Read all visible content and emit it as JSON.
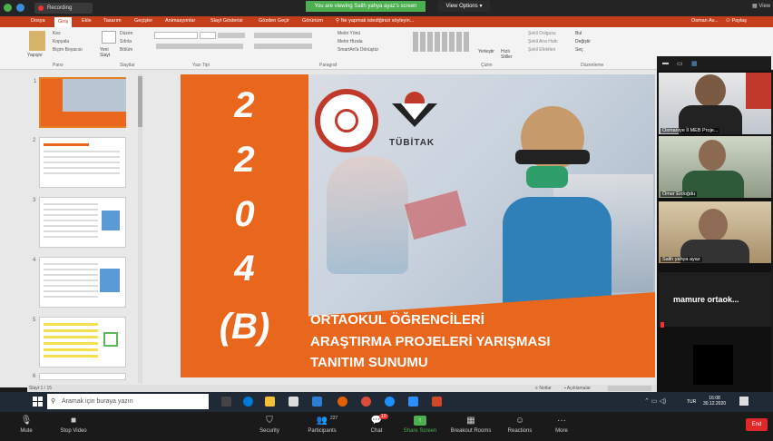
{
  "zoom_top": {
    "recording_label": "Recording",
    "share_banner": "You are viewing Salih yahya ayaz's screen",
    "view_options": "View Options",
    "view_label": "View"
  },
  "ppt": {
    "tabs": [
      "Dosya",
      "Giriş",
      "Ekle",
      "Tasarım",
      "Geçişler",
      "Animasyonlar",
      "Slayt Gösterisi",
      "Gözden Geçir",
      "Görünüm",
      "Ne yapmak istediğinizi söyleyin..."
    ],
    "user": "Osman Av...",
    "share_label": "Paylaş",
    "ribbon_groups": [
      "Pano",
      "Slaytlar",
      "Yazı Tipi",
      "Paragraf",
      "Çizim",
      "Düzenleme"
    ],
    "ribbon_buttons": {
      "paste": "Yapıştır",
      "cut": "Kes",
      "copy": "Kopyala",
      "format_painter": "Biçim Boyacısı",
      "new_slide": "Yeni Slayt",
      "layout": "Düzen",
      "reset": "Sıfırla",
      "section": "Bölüm",
      "text_direction": "Metin Yönü",
      "align_text": "Metni Hizala",
      "smartart": "SmartArt'a Dönüştür",
      "arrange": "Yerleştir",
      "quick_styles": "Hızlı Stiller",
      "shape_fill": "Şekil Dolgusu",
      "shape_outline": "Şekil Ana Hattı",
      "shape_effects": "Şekil Efektleri",
      "find": "Bul",
      "replace": "Değiştir",
      "select": "Seç"
    },
    "thumbnail_numbers": [
      "1",
      "2",
      "3",
      "4",
      "5",
      "6"
    ],
    "slide": {
      "year_digits": [
        "2",
        "2",
        "0",
        "4"
      ],
      "code": "(B)",
      "tubitak_label": "TÜBİTAK",
      "line1": "ORTAOKUL ÖĞRENCİLERİ",
      "line2": "ARAŞTIRMA PROJELERİ YARIŞMASI",
      "line3": "TANITIM SUNUMU"
    },
    "status": {
      "slide_count": "Slayt 1 / 15",
      "notes": "Notlar",
      "comments": "Açıklamalar"
    }
  },
  "gallery": {
    "participants": [
      {
        "name": "Osmaniye İl MEB Proje..."
      },
      {
        "name": "Ömer Erdoğdu"
      },
      {
        "name": "Salih yahya ayaz"
      }
    ],
    "active_speaker": "mamure ortaok..."
  },
  "windows": {
    "search_placeholder": "Aramak için buraya yazın",
    "language": "TUR",
    "time": "16:08",
    "date": "30.12.2020"
  },
  "zoom_bar": {
    "mute": "Mute",
    "stop_video": "Stop Video",
    "security": "Security",
    "participants": "Participants",
    "participants_count": "227",
    "chat": "Chat",
    "chat_badge": "10",
    "share_screen": "Share Screen",
    "breakout": "Breakout Rooms",
    "reactions": "Reactions",
    "more": "More",
    "end": "End"
  },
  "colors": {
    "orange": "#e8671c",
    "ppt_red": "#c43e1c",
    "zoom_green": "#4caf50",
    "end_red": "#e02828"
  }
}
